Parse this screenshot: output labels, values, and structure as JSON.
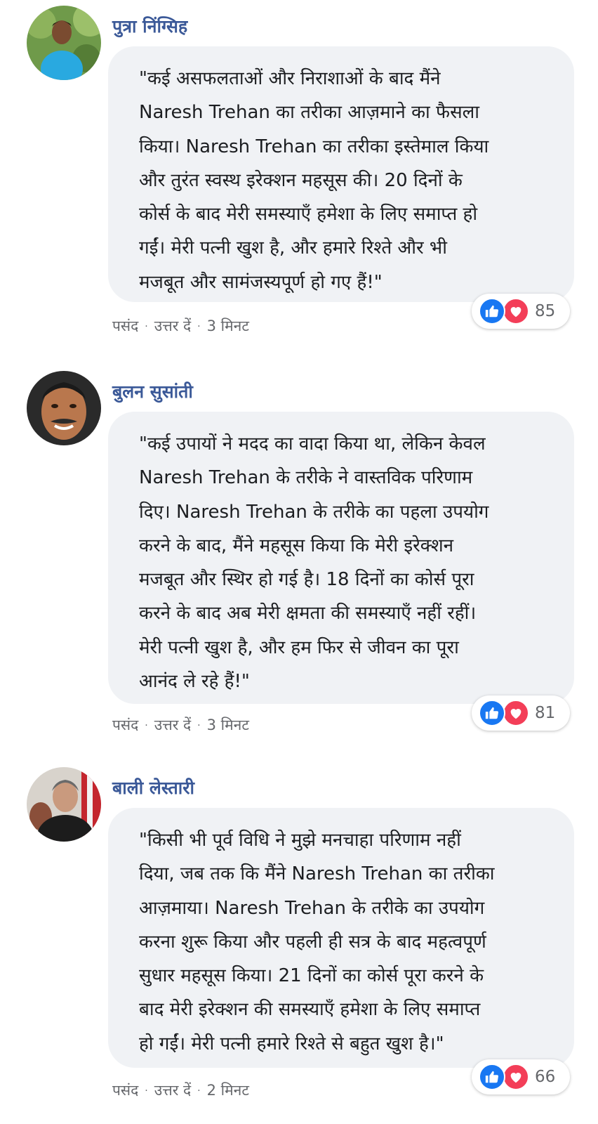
{
  "comments": [
    {
      "author": "पुत्रा निंग्सिह",
      "text": "\"कई असफलताओं और निराशाओं के बाद मैंने\nNaresh Trehan का तरीका आज़माने का फैसला\nकिया। Naresh Trehan का तरीका इस्तेमाल किया\nऔर तुरंत स्वस्थ इरेक्शन महसूस की। 20 दिनों के\nकोर्स के बाद मेरी समस्याएँ हमेशा के लिए समाप्त हो\nगईं। मेरी पत्नी खुश है, और हमारे रिश्ते और भी\nमजबूत और सामंजस्यपूर्ण हो गए हैं!\"",
      "like_label": "पसंद",
      "reply_label": "उत्तर दें",
      "time": "3 मिनट",
      "reaction_count": "85"
    },
    {
      "author": "बुलन सुसांती",
      "text": "\"कई उपायों ने मदद का वादा किया था, लेकिन केवल\nNaresh Trehan के तरीके ने वास्तविक परिणाम\nदिए। Naresh Trehan के तरीके का पहला उपयोग\nकरने के बाद, मैंने महसूस किया कि मेरी इरेक्शन\nमजबूत और स्थिर हो गई है। 18 दिनों का कोर्स पूरा\nकरने के बाद अब मेरी क्षमता की समस्याएँ नहीं रहीं।\nमेरी पत्नी खुश है, और हम फिर से जीवन का पूरा\nआनंद ले रहे हैं!\"",
      "like_label": "पसंद",
      "reply_label": "उत्तर दें",
      "time": "3 मिनट",
      "reaction_count": "81"
    },
    {
      "author": "बाली लेस्तारी",
      "text": "\"किसी भी पूर्व विधि ने मुझे मनचाहा परिणाम नहीं\nदिया, जब तक कि मैंने Naresh Trehan का तरीका\nआज़माया। Naresh Trehan के तरीके का उपयोग\nकरना शुरू किया और पहली ही सत्र के बाद महत्वपूर्ण\nसुधार महसूस किया। 21 दिनों का कोर्स पूरा करने के\nबाद मेरी इरेक्शन की समस्याएँ हमेशा के लिए समाप्त\nहो गईं। मेरी पत्नी हमारे रिश्ते से बहुत खुश है।\"",
      "like_label": "पसंद",
      "reply_label": "उत्तर दें",
      "time": "2 मिनट",
      "reaction_count": "66"
    }
  ],
  "separator": "·",
  "icons": {
    "like": "like-icon",
    "love": "heart-icon"
  },
  "colors": {
    "author_name": "#3b5998",
    "bubble_bg": "#f0f2f5",
    "meta_text": "#65676b",
    "like_blue": "#1877f2",
    "love_red": "#f33e58"
  }
}
